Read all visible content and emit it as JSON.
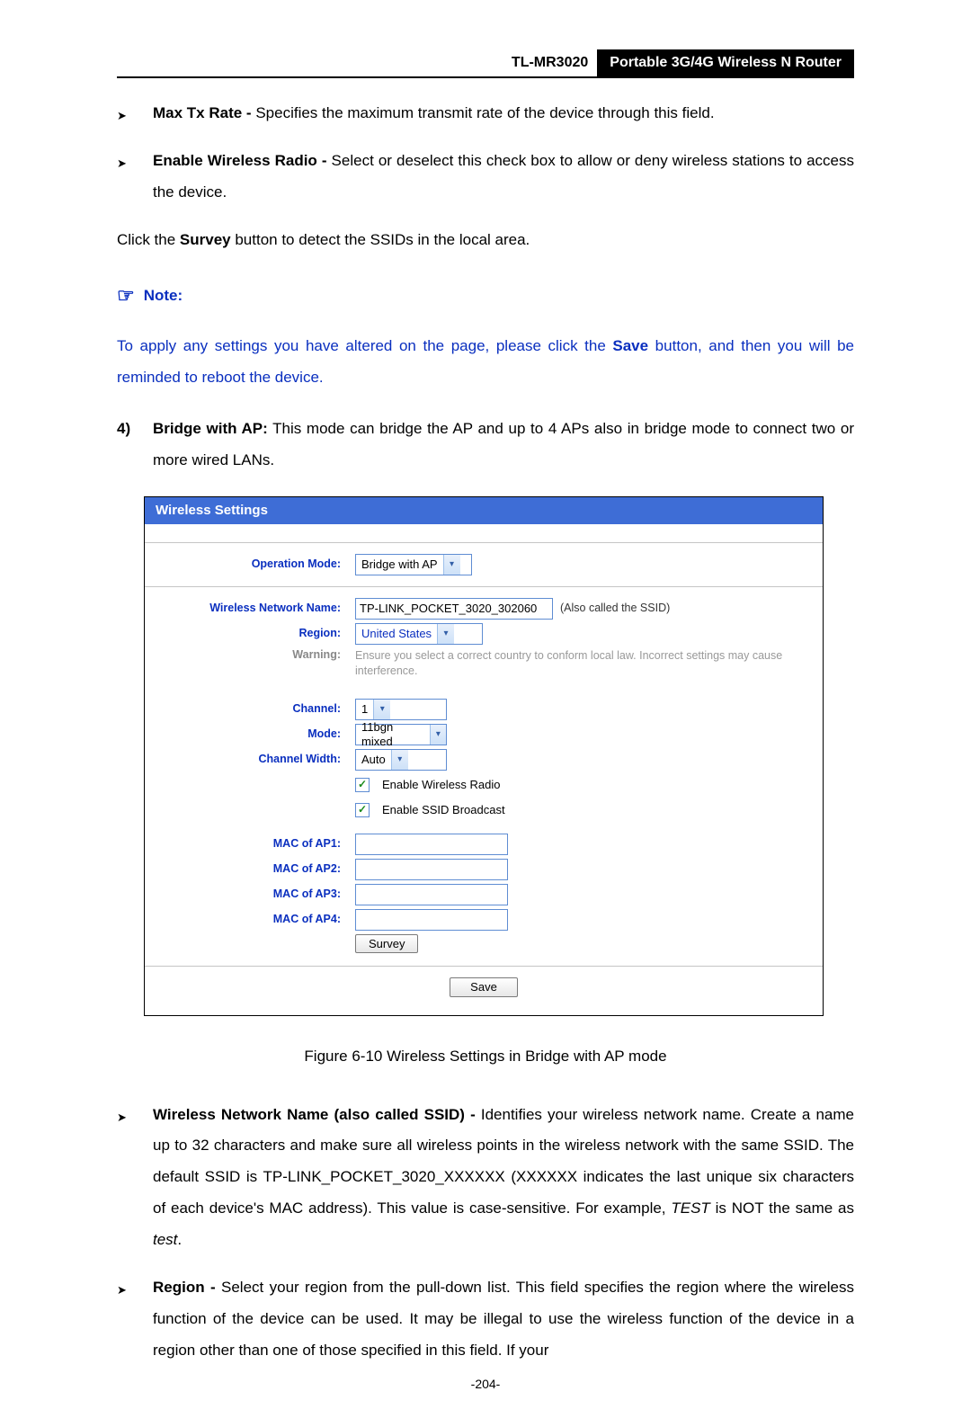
{
  "header": {
    "model": "TL-MR3020",
    "product": "Portable 3G/4G Wireless N Router"
  },
  "bullets_top": [
    {
      "bold": "Max Tx Rate -",
      "rest": " Specifies the maximum transmit rate of the device through this field."
    },
    {
      "bold": "Enable Wireless Radio -",
      "rest": " Select or deselect this check box to allow or deny wireless stations to access the device."
    }
  ],
  "survey_line_pre": "Click the ",
  "survey_bold": "Survey",
  "survey_line_post": " button to detect the SSIDs in the local area.",
  "note": {
    "header": "Note:",
    "body_pre": "To apply any settings you have altered on the page, please click the ",
    "body_bold": "Save",
    "body_post": " button, and then you will be reminded to reboot the device."
  },
  "numbered": {
    "num": "4)",
    "bold": "Bridge with AP:",
    "rest": " This mode can bridge the AP and up to 4 APs also in bridge mode to connect two or more wired LANs."
  },
  "shot": {
    "title": "Wireless Settings",
    "labels": {
      "operation_mode": "Operation Mode:",
      "wireless_name": "Wireless Network Name:",
      "region": "Region:",
      "warning": "Warning:",
      "channel": "Channel:",
      "mode": "Mode:",
      "channel_width": "Channel Width:",
      "mac1": "MAC of AP1:",
      "mac2": "MAC of AP2:",
      "mac3": "MAC of AP3:",
      "mac4": "MAC of AP4:"
    },
    "values": {
      "operation_mode": "Bridge with AP",
      "wireless_name": "TP-LINK_POCKET_3020_302060",
      "ssid_aside": "(Also called the SSID)",
      "region": "United States",
      "warning_text": "Ensure you select a correct country to conform local law. Incorrect settings may cause interference.",
      "channel": "1",
      "mode": "11bgn mixed",
      "channel_width": "Auto",
      "enable_radio": "Enable Wireless Radio",
      "enable_ssid": "Enable SSID Broadcast",
      "survey_btn": "Survey",
      "save_btn": "Save"
    }
  },
  "figure_caption": "Figure 6-10 Wireless Settings in Bridge with AP mode",
  "bullets_bottom": [
    {
      "bold": "Wireless Network Name (also called SSID) -",
      "rest_1": " Identifies your wireless network name. Create a name up to 32 characters and make sure all wireless points in the wireless network with the same SSID. The default SSID is TP-LINK_POCKET_3020_XXXXXX (XXXXXX indicates the last unique six characters of each device's MAC address). This value is case-sensitive. For example, ",
      "italic_1": "TEST",
      "rest_2": " is NOT the same as ",
      "italic_2": "test",
      "rest_3": "."
    },
    {
      "bold": "Region -",
      "rest_1": " Select your region from the pull-down list. This field specifies the region where the wireless function of the device can be used. It may be illegal to use the wireless function of the device in a region other than one of those specified in this field. If your"
    }
  ],
  "page_number": "-204-"
}
